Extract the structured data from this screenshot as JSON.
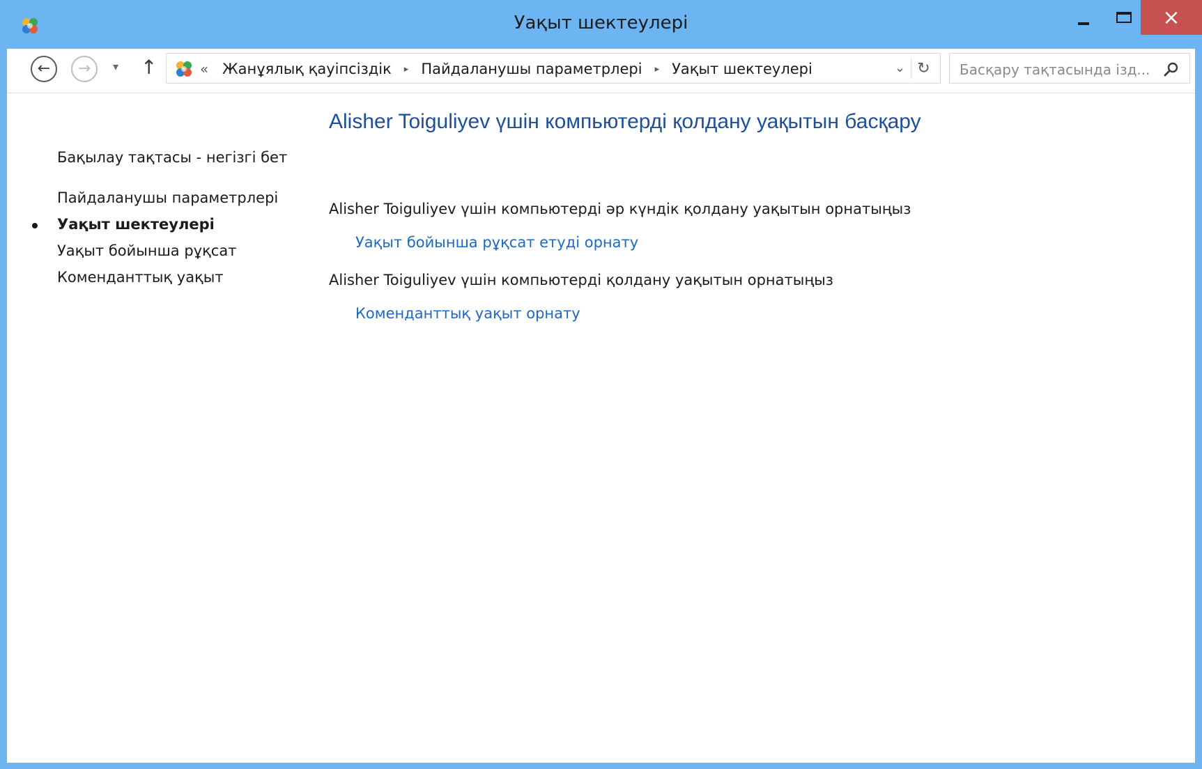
{
  "window": {
    "title": "Уақыт шектеулері",
    "colors": {
      "frame": "#6cb4f2",
      "close": "#c75050",
      "title_link": "#1e4e9c",
      "link": "#1e68c0"
    }
  },
  "window_controls": {
    "minimize": "minimize-icon",
    "maximize": "maximize-icon",
    "close_glyph": "×"
  },
  "nav": {
    "back_glyph": "←",
    "forward_glyph": "→",
    "recent_glyph": "▾",
    "up_glyph": "↑"
  },
  "address": {
    "overflow": "«",
    "crumbs": [
      "Жанұялық қауіпсіздік",
      "Пайдаланушы параметрлері",
      "Уақыт шектеулері"
    ],
    "crumb_sep": "▸",
    "dropdown_glyph": "⌄",
    "refresh_glyph": "↻"
  },
  "search": {
    "placeholder": "Басқару тақтасында ізд..."
  },
  "leftnav": {
    "home": "Бақылау тақтасы - негізгі бет",
    "items": [
      {
        "label": "Пайдаланушы параметрлері",
        "current": false
      },
      {
        "label": "Уақыт шектеулері",
        "current": true
      },
      {
        "label": "Уақыт бойынша рұқсат",
        "current": false
      },
      {
        "label": "Коменданттық уақыт",
        "current": false
      }
    ]
  },
  "main": {
    "title": "Alisher Toiguliyev үшін компьютерді қолдану уақытын басқару",
    "sections": [
      {
        "description": "Alisher Toiguliyev үшін компьютерді әр күндік қолдану уақытын орнатыңыз",
        "link": "Уақыт бойынша рұқсат етуді орнату"
      },
      {
        "description": "Alisher Toiguliyev үшін компьютерді қолдану уақытын орнатыңыз",
        "link": "Коменданттық уақыт орнату"
      }
    ]
  }
}
